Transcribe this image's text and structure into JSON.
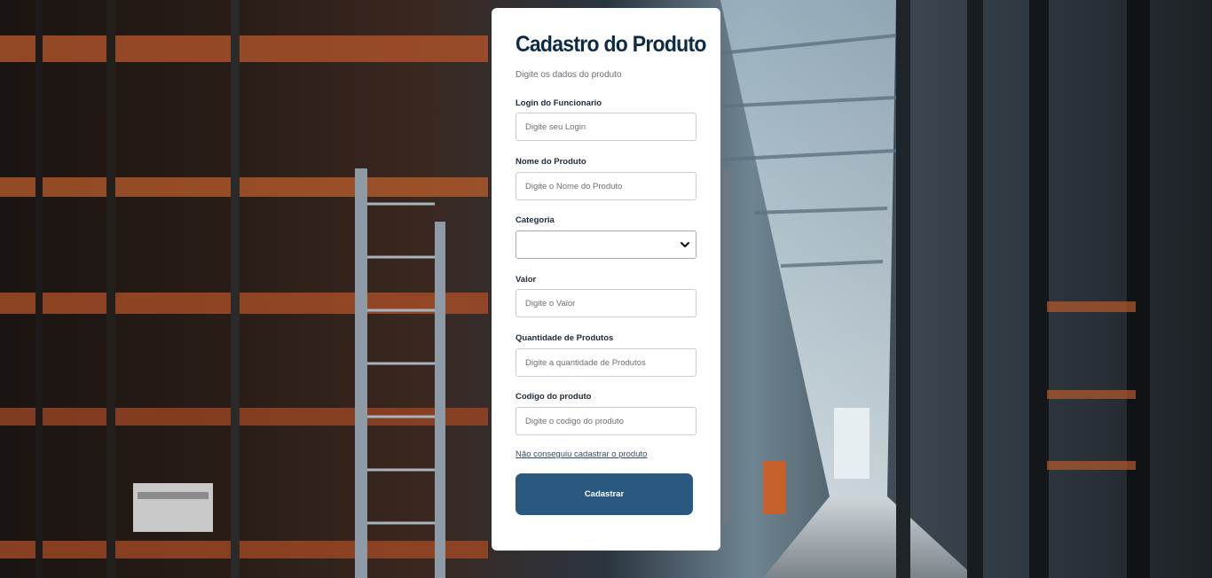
{
  "form": {
    "title": "Cadastro do Produto",
    "subtitle": "Digite os dados do produto",
    "fields": [
      {
        "label": "Login do Funcionario",
        "placeholder": "Digite seu Login"
      },
      {
        "label": "Nome do Produto",
        "placeholder": "Digite o Nome do Produto"
      },
      {
        "label": "Categoria",
        "selected": ""
      },
      {
        "label": "Valor",
        "placeholder": "Digite o Valor"
      },
      {
        "label": "Quantidade de Produtos",
        "placeholder": "Digite a quantidade de Produtos"
      },
      {
        "label": "Codigo do produto",
        "placeholder": "Digite o codigo do produto"
      }
    ],
    "help_link": "Não conseguiu cadastrar o produto",
    "submit_label": "Cadastrar"
  },
  "colors": {
    "title": "#0d2b45",
    "button": "#2a587e",
    "card": "#ffffff"
  },
  "icons": {
    "select_chevron": "chevron-down-icon"
  }
}
